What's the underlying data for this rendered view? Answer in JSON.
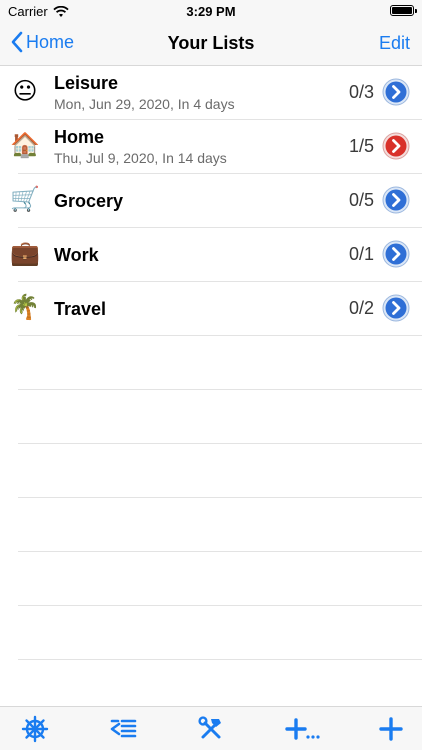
{
  "status_bar": {
    "carrier": "Carrier",
    "time": "3:29 PM"
  },
  "nav": {
    "back_label": "Home",
    "title": "Your Lists",
    "edit_label": "Edit"
  },
  "lists": [
    {
      "emoji": "😐",
      "icon": "smiley-face-icon",
      "name": "Leisure",
      "subtitle": "Mon, Jun 29, 2020, In 4 days",
      "count": "0/3",
      "arrow_color": "#2f6fd6"
    },
    {
      "emoji": "🏠",
      "icon": "house-icon",
      "name": "Home",
      "subtitle": "Thu, Jul 9, 2020, In 14 days",
      "count": "1/5",
      "arrow_color": "#d9312a"
    },
    {
      "emoji": "🛒",
      "icon": "shopping-cart-icon",
      "name": "Grocery",
      "subtitle": "",
      "count": "0/5",
      "arrow_color": "#2f6fd6"
    },
    {
      "emoji": "💼",
      "icon": "briefcase-icon",
      "name": "Work",
      "subtitle": "",
      "count": "0/1",
      "arrow_color": "#2f6fd6"
    },
    {
      "emoji": "🌴",
      "icon": "palm-tree-icon",
      "name": "Travel",
      "subtitle": "",
      "count": "0/2",
      "arrow_color": "#2f6fd6"
    }
  ],
  "toolbar": {
    "accent": "#1a7cf0",
    "items": [
      "ship-wheel-icon",
      "outdent-list-icon",
      "tools-icon",
      "add-more-icon",
      "add-icon"
    ]
  }
}
